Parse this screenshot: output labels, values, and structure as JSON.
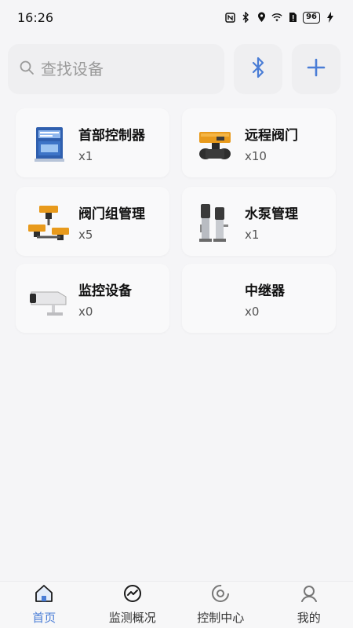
{
  "status_bar": {
    "time": "16:26",
    "battery": "96",
    "icons": [
      "nfc-icon",
      "bluetooth-icon",
      "location-icon",
      "wifi-icon",
      "sim-alert-icon",
      "battery-icon",
      "charging-icon"
    ]
  },
  "search": {
    "placeholder": "查找设备",
    "value": ""
  },
  "toolbar": {
    "bluetooth_icon": "bluetooth-icon",
    "add_icon": "plus-icon",
    "accent_color": "#4a7dd6"
  },
  "devices": [
    {
      "name": "首部控制器",
      "count": "x1",
      "icon": "controller-box-icon"
    },
    {
      "name": "远程阀门",
      "count": "x10",
      "icon": "valve-icon"
    },
    {
      "name": "阀门组管理",
      "count": "x5",
      "icon": "valve-group-icon"
    },
    {
      "name": "水泵管理",
      "count": "x1",
      "icon": "pump-icon"
    },
    {
      "name": "监控设备",
      "count": "x0",
      "icon": "camera-icon"
    },
    {
      "name": "中继器",
      "count": "x0",
      "icon": ""
    }
  ],
  "nav": {
    "items": [
      {
        "label": "首页",
        "icon": "home-icon",
        "active": true
      },
      {
        "label": "监测概况",
        "icon": "monitor-icon",
        "active": false
      },
      {
        "label": "控制中心",
        "icon": "control-icon",
        "active": false
      },
      {
        "label": "我的",
        "icon": "profile-icon",
        "active": false
      }
    ]
  }
}
